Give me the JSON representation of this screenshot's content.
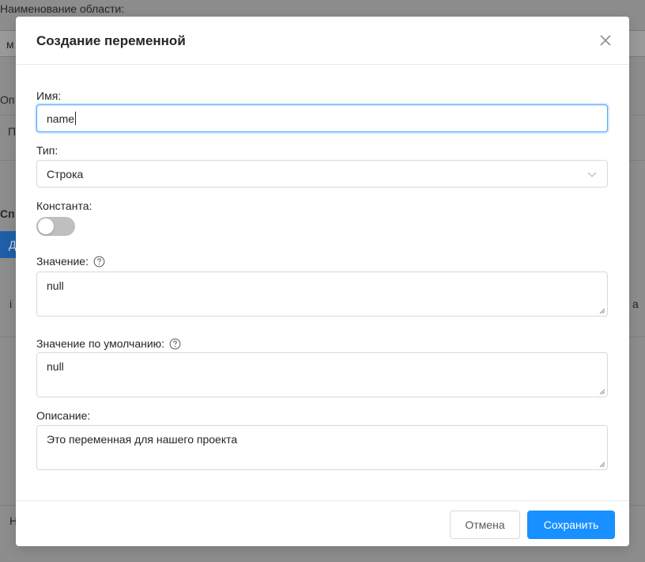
{
  "background": {
    "area_name_label": "Наименование области:",
    "frag_1": "м",
    "frag_2": "Оп",
    "frag_3": "П",
    "frag_4": "Сп",
    "frag_5": "Д",
    "frag_6": "i",
    "frag_7": "а",
    "frag_8": "Н"
  },
  "modal": {
    "title": "Создание переменной",
    "close_icon": "close-icon",
    "fields": {
      "name": {
        "label": "Имя:",
        "value": "name"
      },
      "type": {
        "label": "Тип:",
        "value": "Строка"
      },
      "constant": {
        "label": "Константа:",
        "checked": false
      },
      "value": {
        "label": "Значение:",
        "text": "null",
        "help_icon": "question-circle-icon"
      },
      "default_value": {
        "label": "Значение по умолчанию:",
        "text": "null",
        "help_icon": "question-circle-icon"
      },
      "description": {
        "label": "Описание:",
        "text": "Это переменная для нашего проекта"
      }
    },
    "footer": {
      "cancel_label": "Отмена",
      "save_label": "Сохранить"
    }
  },
  "colors": {
    "primary": "#1890ff",
    "focus_border": "#4aa3ff",
    "toggle_off": "#bfbfbf",
    "overlay": "#8d8d8d"
  }
}
